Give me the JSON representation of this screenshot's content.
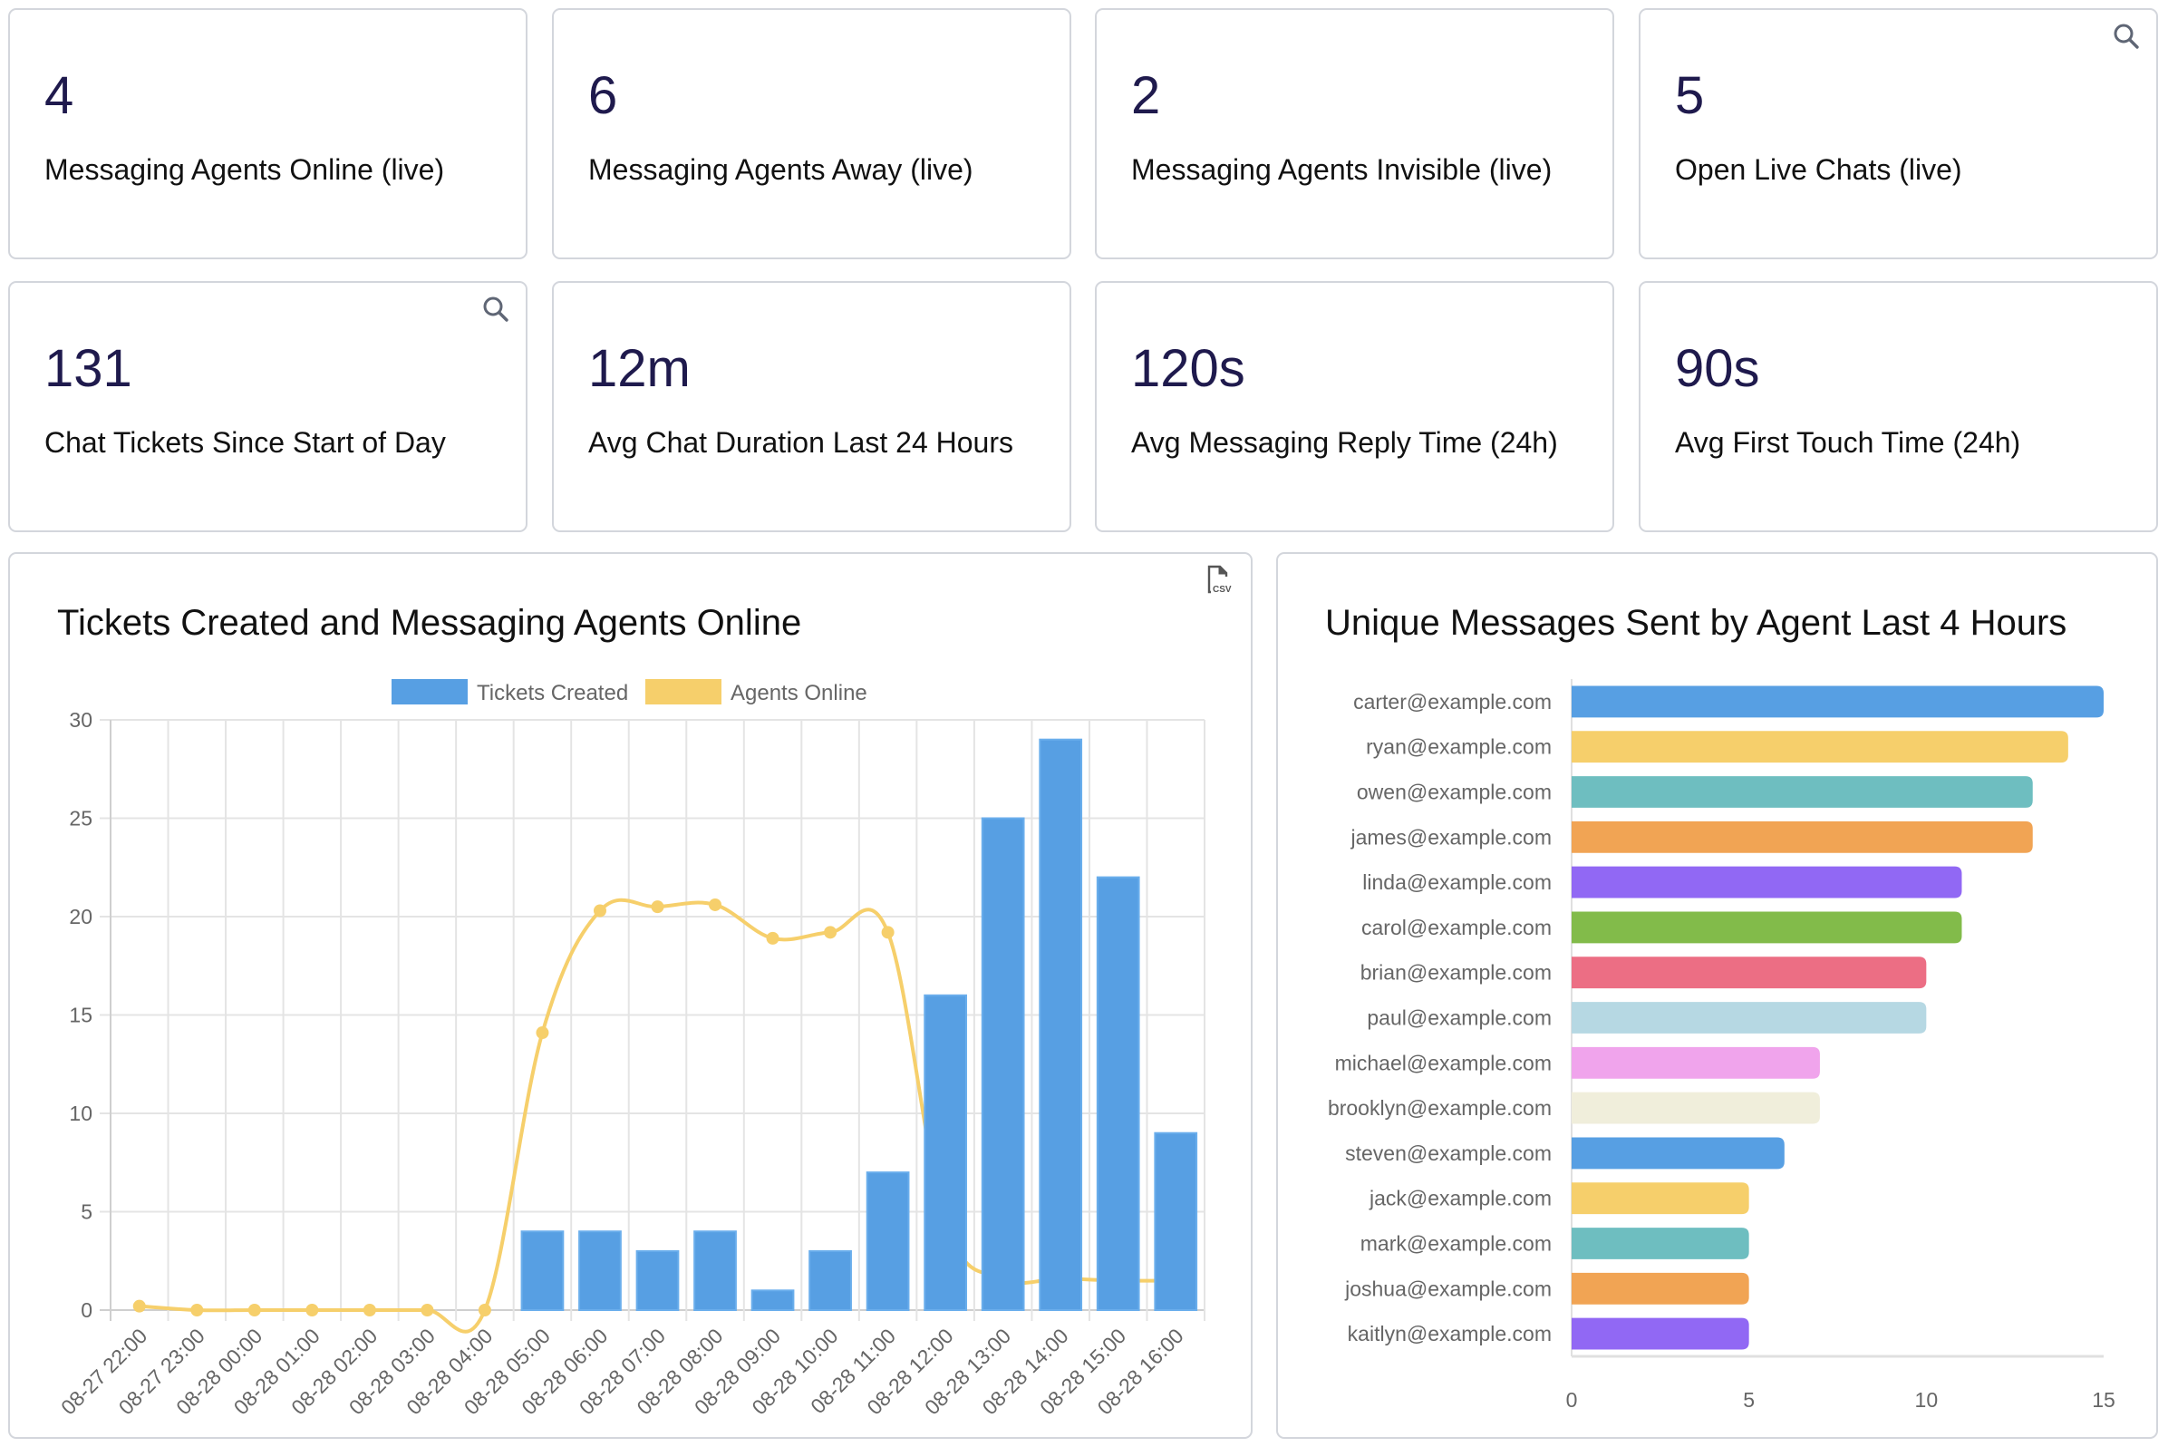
{
  "stats": [
    {
      "value": "4",
      "label": "Messaging Agents Online (live)",
      "icon": null
    },
    {
      "value": "6",
      "label": "Messaging Agents Away (live)",
      "icon": null
    },
    {
      "value": "2",
      "label": "Messaging Agents Invisible (live)",
      "icon": null
    },
    {
      "value": "5",
      "label": "Open Live Chats (live)",
      "icon": "search-icon"
    },
    {
      "value": "131",
      "label": "Chat Tickets Since Start of Day",
      "icon": "search-icon"
    },
    {
      "value": "12m",
      "label": "Avg Chat Duration Last 24 Hours",
      "icon": null
    },
    {
      "value": "120s",
      "label": "Avg Messaging Reply Time (24h)",
      "icon": null
    },
    {
      "value": "90s",
      "label": "Avg First Touch Time (24h)",
      "icon": null
    }
  ],
  "tickets_panel": {
    "title": "Tickets Created and Messaging Agents Online",
    "export_icon": "csv-file-icon",
    "export_label": "CSV"
  },
  "agents_panel": {
    "title": "Unique Messages Sent by Agent Last 4 Hours"
  },
  "colors": {
    "tickets": "#579fe3",
    "agents_online": "#f6cf6b",
    "stat_value": "#1f1a4d"
  },
  "chart_data": [
    {
      "type": "bar",
      "title": "Tickets Created and Messaging Agents Online",
      "xlabel": "",
      "ylabel": "",
      "ylim": [
        0,
        30
      ],
      "yticks": [
        0,
        5,
        10,
        15,
        20,
        25,
        30
      ],
      "grid": true,
      "legend": "top-center",
      "categories": [
        "08-27 22:00",
        "08-27 23:00",
        "08-28 00:00",
        "08-28 01:00",
        "08-28 02:00",
        "08-28 03:00",
        "08-28 04:00",
        "08-28 05:00",
        "08-28 06:00",
        "08-28 07:00",
        "08-28 08:00",
        "08-28 09:00",
        "08-28 10:00",
        "08-28 11:00",
        "08-28 12:00",
        "08-28 13:00",
        "08-28 14:00",
        "08-28 15:00",
        "08-28 16:00"
      ],
      "series": [
        {
          "name": "Tickets Created",
          "type": "bar",
          "color": "#579fe3",
          "values": [
            0,
            0,
            0,
            0,
            0,
            0,
            0,
            4,
            4,
            3,
            4,
            1,
            3,
            7,
            16,
            25,
            29,
            22,
            9
          ]
        },
        {
          "name": "Agents Online",
          "type": "line",
          "color": "#f6cf6b",
          "values": [
            0.2,
            0,
            0,
            0,
            0,
            0,
            0,
            14.1,
            20.3,
            20.5,
            20.6,
            18.9,
            19.2,
            19.2,
            4.5,
            1.6,
            1.6,
            1.5,
            1.5
          ]
        }
      ]
    },
    {
      "type": "bar",
      "orientation": "horizontal",
      "title": "Unique Messages Sent by Agent Last 4 Hours",
      "xlabel": "",
      "ylabel": "",
      "xlim": [
        0,
        15
      ],
      "xticks": [
        0,
        5,
        10,
        15
      ],
      "grid": false,
      "categories": [
        "carter@example.com",
        "ryan@example.com",
        "owen@example.com",
        "james@example.com",
        "linda@example.com",
        "carol@example.com",
        "brian@example.com",
        "paul@example.com",
        "michael@example.com",
        "brooklyn@example.com",
        "steven@example.com",
        "jack@example.com",
        "mark@example.com",
        "joshua@example.com",
        "kaitlyn@example.com"
      ],
      "values": [
        15,
        14,
        13,
        13,
        11,
        11,
        10,
        10,
        7,
        7,
        6,
        5,
        5,
        5,
        5
      ],
      "colors": [
        "#579fe3",
        "#f6cf6b",
        "#6ebec0",
        "#f1a454",
        "#9168f4",
        "#82bb4a",
        "#ec6e84",
        "#b6d8e3",
        "#f0a4ec",
        "#f0eedb",
        "#579fe3",
        "#f6cf6b",
        "#6ebec0",
        "#f1a454",
        "#9168f4"
      ]
    }
  ]
}
